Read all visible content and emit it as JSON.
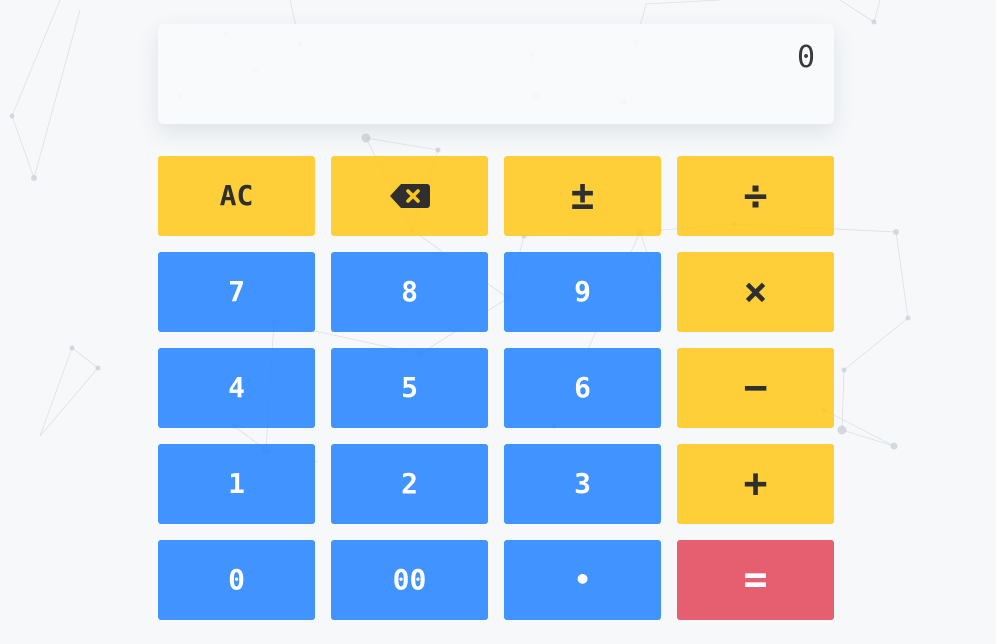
{
  "display": {
    "value": "0"
  },
  "keys": {
    "all_clear": "AC",
    "backspace_icon": "backspace-icon",
    "plus_minus": "±",
    "divide": "÷",
    "seven": "7",
    "eight": "8",
    "nine": "9",
    "multiply": "×",
    "four": "4",
    "five": "5",
    "six": "6",
    "minus": "−",
    "one": "1",
    "two": "2",
    "three": "3",
    "plus": "+",
    "zero": "0",
    "double_zero": "00",
    "decimal": "•",
    "equals": "="
  },
  "colors": {
    "background": "#f6f8fa",
    "function_key": "#ffc81e",
    "digit_key": "#2d87ff",
    "equals_key": "#e34e60",
    "dark_text": "#2f2f2f"
  }
}
